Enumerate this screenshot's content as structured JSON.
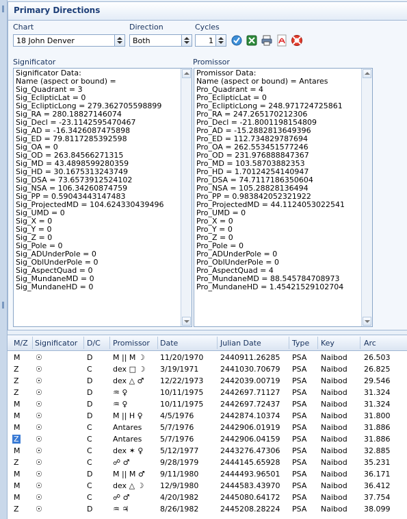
{
  "panel": {
    "title": "Primary Directions"
  },
  "controls": {
    "chart_label": "Chart",
    "chart_value": "18 John Denver",
    "direction_label": "Direction",
    "direction_value": "Both",
    "cycles_label": "Cycles",
    "cycles_value": "1"
  },
  "toolbar": {
    "icons": [
      "calculate-icon",
      "export-excel-icon",
      "print-icon",
      "pdf-icon",
      "help-icon"
    ]
  },
  "significator": {
    "label": "Significator",
    "text": "Significator Data:\nName (aspect or bound) =\nSig_Quadrant = 3\nSig_EclipticLat = 0\nSig_EclipticLong = 279.362705598899\nSig_RA = 280.18827146074\nSig_Decl = -23.1142595470467\nSig_AD = -16.3426087475898\nSig_ED = 79.8117285392598\nSig_OA = 0\nSig_OD = 263.84566271315\nSig_MD = 43.4898599280359\nSig_HD = 30.1675313243749\nSig_DSA = 73.6573912524102\nSig_NSA = 106.34260874759\nSig_PP = 0.59043443147483\nSig_ProjectedMD = 104.624330439496\nSig_UMD = 0\nSig_X = 0\nSig_Y = 0\nSig_Z = 0\nSig_Pole = 0\nSig_ADUnderPole = 0\nSig_OblUnderPole = 0\nSig_AspectQuad = 0\nSig_MundaneMD = 0\nSig_MundaneHD = 0"
  },
  "promissor": {
    "label": "Promissor",
    "text": "Promissor Data:\nName (aspect or bound) = Antares\nPro_Quadrant = 4\nPro_EclipticLat = 0\nPro_EclipticLong = 248.971724725861\nPro_RA = 247.265170212306\nPro_Decl = -21.8001198154809\nPro_AD = -15.2882813649396\nPro_ED = 112.734829787694\nPro_OA = 262.553451577246\nPro_OD = 231.976888847367\nPro_MD = 103.58703882353\nPro_HD = 1.70124254140947\nPro_DSA = 74.7117186350604\nPro_NSA = 105.28828136494\nPro_PP = 0.983842052321922\nPro_ProjectedMD = 44.1124053022541\nPro_UMD = 0\nPro_X = 0\nPro_Y = 0\nPro_Z = 0\nPro_Pole = 0\nPro_ADUnderPole = 0\nPro_OblUnderPole = 0\nPro_AspectQuad = 4\nPro_MundaneMD = 88.545784708973\nPro_MundaneHD = 1.45421529102704"
  },
  "grid": {
    "headers": [
      "M/Z",
      "Significator",
      "D/C",
      "Promissor",
      "Date",
      "Julian Date",
      "Type",
      "Key",
      "Arc"
    ],
    "rows": [
      [
        "M",
        "☉",
        "D",
        "M || M ☽",
        "11/20/1970",
        "2440911.26285",
        "PSA",
        "Naibod",
        "26.503"
      ],
      [
        "Z",
        "☉",
        "C",
        "dex □ ☽",
        "3/19/1971",
        "2441030.70679",
        "PSA",
        "Naibod",
        "26.825"
      ],
      [
        "Z",
        "☉",
        "D",
        "dex △ ♂",
        "12/22/1973",
        "2442039.00719",
        "PSA",
        "Naibod",
        "29.546"
      ],
      [
        "Z",
        "☉",
        "D",
        "♒ ♀",
        "10/11/1975",
        "2442697.71127",
        "PSA",
        "Naibod",
        "31.324"
      ],
      [
        "M",
        "☉",
        "D",
        "♒ ♀",
        "10/11/1975",
        "2442697.72437",
        "PSA",
        "Naibod",
        "31.324"
      ],
      [
        "M",
        "☉",
        "D",
        "M || H ♀",
        "4/5/1976",
        "2442874.10374",
        "PSA",
        "Naibod",
        "31.800"
      ],
      [
        "M",
        "☉",
        "C",
        "Antares",
        "5/7/1976",
        "2442906.01919",
        "PSA",
        "Naibod",
        "31.886"
      ],
      [
        "Z",
        "☉",
        "C",
        "Antares",
        "5/7/1976",
        "2442906.04159",
        "PSA",
        "Naibod",
        "31.886"
      ],
      [
        "M",
        "☉",
        "C",
        "dex ✶ ♀",
        "5/12/1977",
        "2443276.47306",
        "PSA",
        "Naibod",
        "32.885"
      ],
      [
        "Z",
        "☉",
        "C",
        "☍ ♂",
        "9/28/1979",
        "2444145.65928",
        "PSA",
        "Naibod",
        "35.231"
      ],
      [
        "M",
        "☉",
        "D",
        "M || M ♂",
        "9/11/1980",
        "2444493.96501",
        "PSA",
        "Naibod",
        "36.171"
      ],
      [
        "M",
        "☉",
        "C",
        "dex △ ☽",
        "12/9/1980",
        "2444583.43970",
        "PSA",
        "Naibod",
        "36.412"
      ],
      [
        "M",
        "☉",
        "C",
        "☍ ♂",
        "4/20/1982",
        "2445080.64172",
        "PSA",
        "Naibod",
        "37.754"
      ],
      [
        "Z",
        "☉",
        "D",
        "♒ ♃",
        "8/26/1982",
        "2445208.28224",
        "PSA",
        "Naibod",
        "38.099"
      ]
    ],
    "selected_row": 7
  }
}
